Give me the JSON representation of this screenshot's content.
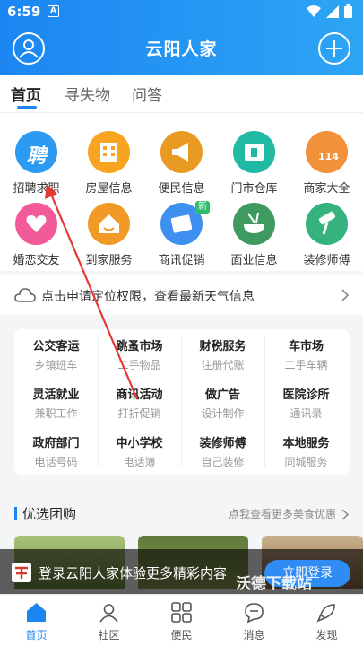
{
  "status_bar": {
    "time": "6:59",
    "notification": "A"
  },
  "header": {
    "title": "云阳人家"
  },
  "tabs": [
    {
      "label": "首页"
    },
    {
      "label": "寻失物"
    },
    {
      "label": "问答"
    }
  ],
  "grid": [
    {
      "label": "招聘求职",
      "icon": "recruit-icon",
      "color": "#2b9af3",
      "glyph": "聘"
    },
    {
      "label": "房屋信息",
      "icon": "building-icon",
      "color": "#f7a521"
    },
    {
      "label": "便民信息",
      "icon": "megaphone-icon",
      "color": "#e89a22"
    },
    {
      "label": "门市仓库",
      "icon": "shop-icon",
      "color": "#1fb9a4"
    },
    {
      "label": "商家大全",
      "icon": "phone-114-icon",
      "color": "#f2913a",
      "glyph": "114"
    },
    {
      "label": "婚恋交友",
      "icon": "hearts-icon",
      "color": "#f25a9a"
    },
    {
      "label": "到家服务",
      "icon": "home-service-icon",
      "color": "#f29a26"
    },
    {
      "label": "商讯促销",
      "icon": "promotion-icon",
      "color": "#3d8ff0",
      "badge": "新"
    },
    {
      "label": "面业信息",
      "icon": "noodle-icon",
      "color": "#3e9a5f"
    },
    {
      "label": "装修师傅",
      "icon": "roller-icon",
      "color": "#35b27e"
    }
  ],
  "weather": {
    "text": "点击申请定位权限，查看最新天气信息"
  },
  "services": [
    {
      "title": "公交客运",
      "sub": "乡镇班车"
    },
    {
      "title": "跳蚤市场",
      "sub": "二手物品"
    },
    {
      "title": "财税服务",
      "sub": "注册代账"
    },
    {
      "title": "车市场",
      "sub": "二手车辆"
    },
    {
      "title": "灵活就业",
      "sub": "兼职工作"
    },
    {
      "title": "商讯活动",
      "sub": "打折促销"
    },
    {
      "title": "做广告",
      "sub": "设计制作"
    },
    {
      "title": "医院诊所",
      "sub": "通讯录"
    },
    {
      "title": "政府部门",
      "sub": "电话号码"
    },
    {
      "title": "中小学校",
      "sub": "电话簿"
    },
    {
      "title": "装修师傅",
      "sub": "自己装修"
    },
    {
      "title": "本地服务",
      "sub": "同城服务"
    }
  ],
  "group_buy": {
    "title": "优选团购",
    "more": "点我查看更多美食优惠"
  },
  "login_banner": {
    "text": "登录云阳人家体验更多精彩内容",
    "button": "立即登录"
  },
  "watermark": "沃德下载站",
  "bottom_nav": [
    {
      "label": "首页",
      "icon": "home-icon",
      "active": true
    },
    {
      "label": "社区",
      "icon": "community-icon"
    },
    {
      "label": "便民",
      "icon": "grid-apps-icon"
    },
    {
      "label": "消息",
      "icon": "message-icon"
    },
    {
      "label": "发现",
      "icon": "rocket-icon"
    }
  ],
  "colors": {
    "primary": "#1b86f2",
    "annotation_arrow": "#e53935"
  }
}
